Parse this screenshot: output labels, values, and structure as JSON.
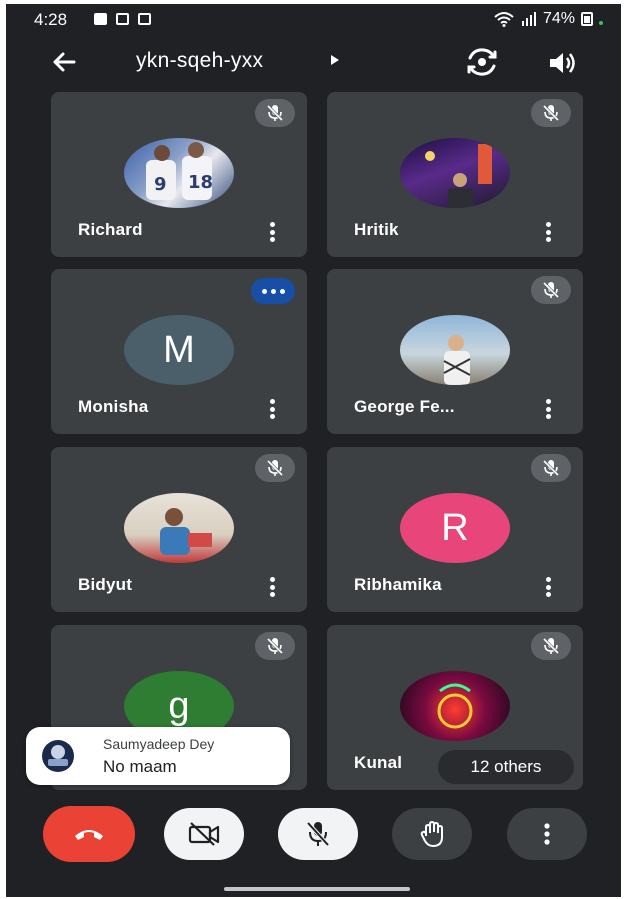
{
  "status": {
    "time": "4:28",
    "battery": "74%"
  },
  "meeting": {
    "code": "ykn-sqeh-yxx"
  },
  "participants": [
    {
      "name": "Richard"
    },
    {
      "name": "Hritik"
    },
    {
      "name": "Monisha",
      "initial": "M"
    },
    {
      "name": "George Fe..."
    },
    {
      "name": "Bidyut"
    },
    {
      "name": "Ribhamika",
      "initial": "R"
    },
    {
      "name": "",
      "initial": "g"
    },
    {
      "name": "Kunal"
    }
  ],
  "others": {
    "label": "12 others"
  },
  "chat": {
    "sender": "Saumyadeep Dey",
    "message": "No maam"
  },
  "colors": {
    "background": "#202124",
    "tile": "#3c4043",
    "end_call": "#ea4335",
    "speaking": "#174ea6",
    "monisha_avatar": "#4a5f6a",
    "ribhamika_avatar": "#e8457a",
    "g_avatar": "#2e7d32"
  }
}
